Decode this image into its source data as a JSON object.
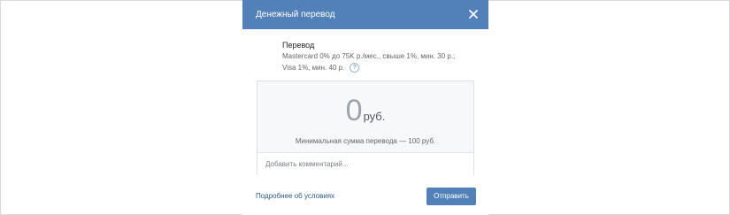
{
  "dialog": {
    "title": "Денежный перевод",
    "close_icon": "close-icon"
  },
  "transfer_info": {
    "title": "Перевод",
    "line1": "Mastercard 0% до 75K р./мес., свыше 1%, мин. 30 р.;",
    "line2": "Visa 1%, мин. 40 р.",
    "help_icon": "question-icon",
    "help_glyph": "?"
  },
  "amount": {
    "value": "0",
    "unit": "руб.",
    "min_text": "Минимальная сумма перевода — 100 руб."
  },
  "comment": {
    "placeholder": "Добавить комментарий..."
  },
  "footer": {
    "conditions_link": "Подробнее об условиях",
    "send_button": "Отправить"
  },
  "colors": {
    "header": "#5181b8",
    "link": "#2a5885",
    "button": "#5181b8"
  }
}
